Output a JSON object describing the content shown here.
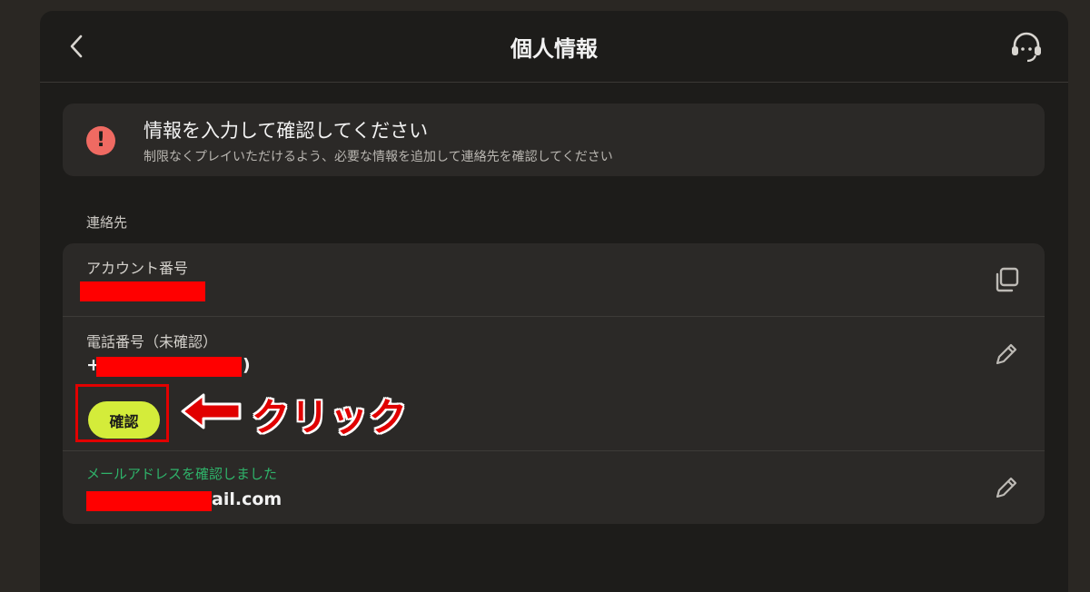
{
  "header": {
    "title": "個人情報",
    "back_icon": "chevron-left-icon",
    "support_icon": "headset-icon"
  },
  "alert": {
    "title": "情報を入力して確認してください",
    "description": "制限なくプレイいただけるよう、必要な情報を追加して連絡先を確認してください",
    "icon": "exclamation-icon",
    "icon_color": "#ef6a62"
  },
  "contact": {
    "section_label": "連絡先",
    "account": {
      "label": "アカウント番号",
      "copy_icon": "copy-icon"
    },
    "phone": {
      "label": "電話番号（未確認）",
      "prefix": "+",
      "suffix": ")",
      "confirm_label": "確認",
      "edit_icon": "pencil-icon"
    },
    "email": {
      "status": "メールアドレスを確認しました",
      "visible_part": "ail.com",
      "edit_icon": "pencil-icon"
    }
  },
  "annotation": {
    "click_label": "クリック",
    "color": "#e10000"
  },
  "colors": {
    "confirm_button": "#d4ec3a",
    "verified_green": "#2fb36a",
    "redaction": "#ff0000"
  }
}
